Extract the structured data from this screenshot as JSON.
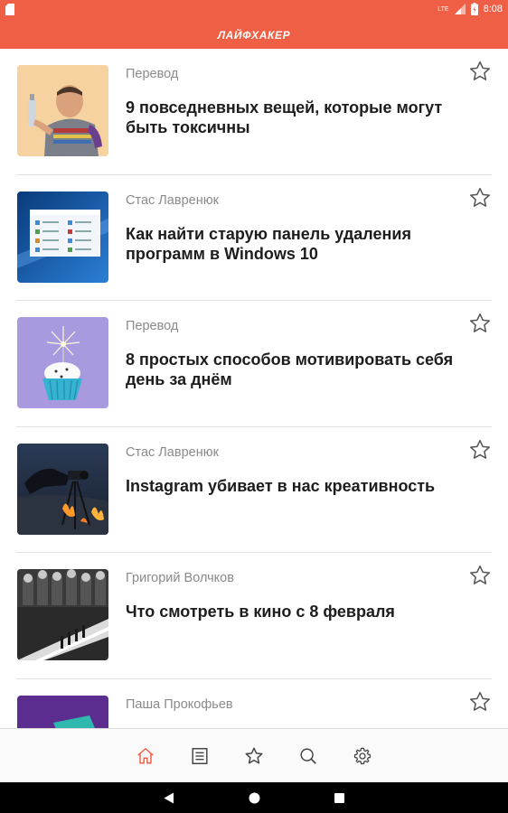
{
  "status_bar": {
    "network": "LTE",
    "time": "8:08",
    "icons": [
      "sd-card-icon",
      "signal-icon",
      "battery-icon"
    ]
  },
  "app_bar": {
    "title": "ЛАЙФХАКЕР"
  },
  "accent_color": "#ef5f45",
  "articles": [
    {
      "author": "Перевод",
      "title": "9 повседневных вещей, которые могут быть токсичны",
      "thumb": "man-with-spray-can"
    },
    {
      "author": "Стас Лавренюк",
      "title": "Как найти старую панель удаления программ в Windows 10",
      "thumb": "windows-control-panel"
    },
    {
      "author": "Перевод",
      "title": "8 простых способов мотивировать себя день за днём",
      "thumb": "cupcake-sparkler"
    },
    {
      "author": "Стас Лавренюк",
      "title": "Instagram убивает в нас креативность",
      "thumb": "photographer-tripod"
    },
    {
      "author": "Григорий Волчков",
      "title": "Что смотреть в кино с 8 февраля",
      "thumb": "movie-poster"
    },
    {
      "author": "Паша Прокофьев",
      "title": "",
      "thumb": "purple-gadget"
    }
  ],
  "bottom_nav": [
    {
      "name": "home",
      "icon": "home-icon",
      "active": true
    },
    {
      "name": "feed",
      "icon": "list-icon",
      "active": false
    },
    {
      "name": "favorites",
      "icon": "star-icon",
      "active": false
    },
    {
      "name": "search",
      "icon": "search-icon",
      "active": false
    },
    {
      "name": "settings",
      "icon": "gear-icon",
      "active": false
    }
  ],
  "system_nav": [
    "back-icon",
    "home-circle-icon",
    "recents-icon"
  ]
}
